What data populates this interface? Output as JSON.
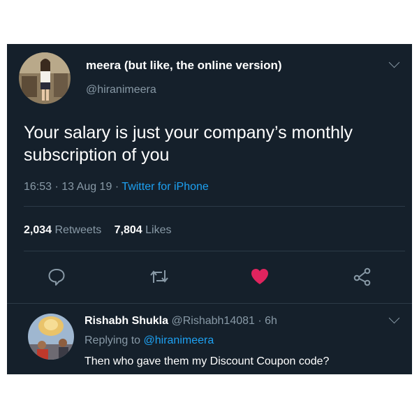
{
  "tweet": {
    "author_name": "meera (but like, the online version)",
    "author_handle": "@hiranimeera",
    "text": "Your salary is just your company’s monthly subscription of you",
    "time": "16:53",
    "date": "13 Aug 19",
    "source": "Twitter for iPhone",
    "sep": "·",
    "retweets_count": "2,034",
    "retweets_label": "Retweets",
    "likes_count": "7,804",
    "likes_label": "Likes"
  },
  "actions": [
    {
      "name": "reply-icon"
    },
    {
      "name": "retweet-icon"
    },
    {
      "name": "like-icon",
      "color": "#e0245e"
    },
    {
      "name": "share-icon"
    }
  ],
  "reply": {
    "author_name": "Rishabh Shukla",
    "author_handle": "@Rishabh14081",
    "age": "6h",
    "replying_to_label": "Replying to",
    "replying_to_handle": "@hiranimeera",
    "text": "Then who gave them my Discount Coupon code?"
  },
  "colors": {
    "background": "#15202b",
    "text": "#ffffff",
    "muted": "#8899a6",
    "link": "#1da1f2",
    "like": "#e0245e"
  }
}
